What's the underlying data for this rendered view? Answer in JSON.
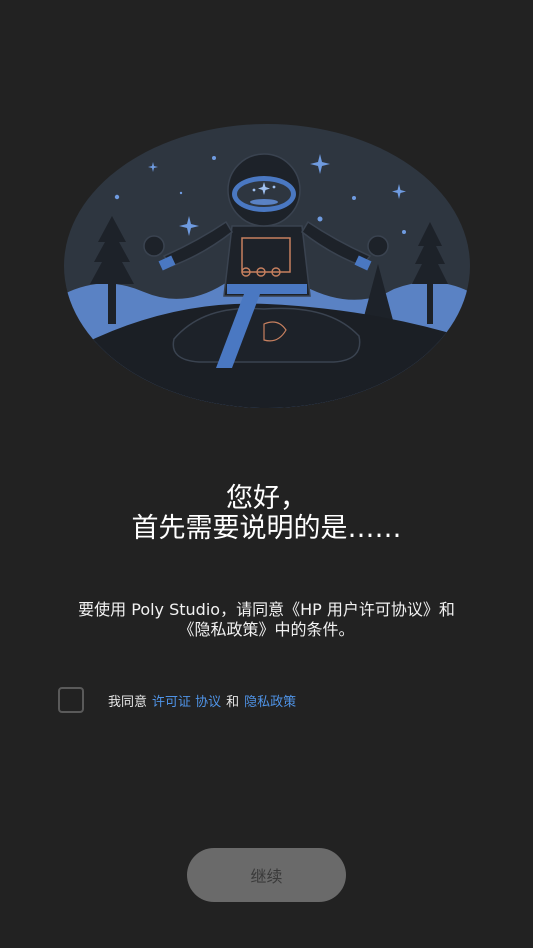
{
  "onboarding": {
    "greeting_line1": "您好，",
    "greeting_line2": "首先需要说明的是……",
    "description_line1": "要使用 Poly Studio，请同意《HP 用户许可协议》和",
    "description_line2": "《隐私政策》中的条件。"
  },
  "consent": {
    "checked": false,
    "prefix": "我同意",
    "license_link": "许可证 协议",
    "conjunction": "和",
    "privacy_link": "隐私政策"
  },
  "continue_button": {
    "label": "继续",
    "enabled": false
  },
  "colors": {
    "background": "#222222",
    "link": "#4f93e6",
    "button_disabled": "#6a6a6a",
    "illustration_accent": "#4a78c2"
  },
  "illustration": {
    "icon": "meditating-astronaut-illustration"
  }
}
